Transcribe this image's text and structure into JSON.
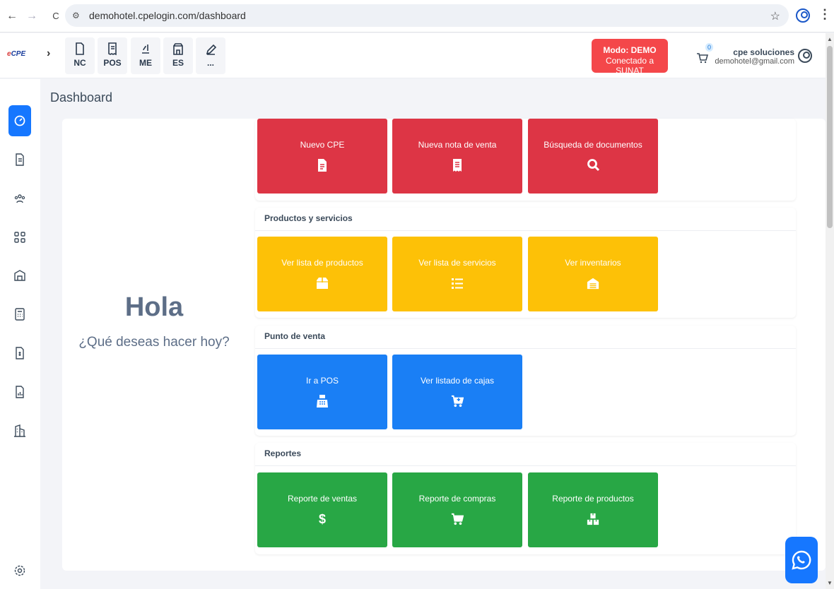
{
  "browser": {
    "url": "demohotel.cpelogin.com/dashboard",
    "back_icon": "←",
    "forward_icon": "→",
    "reload_icon": "C",
    "star_icon": "☆"
  },
  "topbar": {
    "logo_text_a": "CPE",
    "logo_text_b": "e",
    "expand_icon": "›",
    "quick_actions": [
      {
        "label": "NC",
        "icon": "doc-icon"
      },
      {
        "label": "POS",
        "icon": "receipt-icon"
      },
      {
        "label": "ME",
        "icon": "signature-icon"
      },
      {
        "label": "ES",
        "icon": "store-icon"
      },
      {
        "label": "...",
        "icon": "edit-icon"
      }
    ],
    "mode": {
      "title": "Modo: DEMO",
      "subtitle": "Conectado a SUNAT",
      "color": "#f4474a"
    },
    "cart_count": "0",
    "user_name": "cpe soluciones",
    "user_email": "demohotel@gmail.com"
  },
  "page": {
    "title": "Dashboard",
    "greeting": "Hola",
    "greeting_sub": "¿Qué deseas hacer hoy?"
  },
  "sections": [
    {
      "title": "",
      "color": "#dd3545",
      "tiles": [
        {
          "label": "Nuevo CPE",
          "icon": "file-icon"
        },
        {
          "label": "Nueva nota de venta",
          "icon": "receipt-icon"
        },
        {
          "label": "Búsqueda de documentos",
          "icon": "search-icon"
        }
      ]
    },
    {
      "title": "Productos y servicios",
      "color": "#fdc107",
      "tiles": [
        {
          "label": "Ver lista de productos",
          "icon": "box-icon"
        },
        {
          "label": "Ver lista de servicios",
          "icon": "list-icon"
        },
        {
          "label": "Ver inventarios",
          "icon": "warehouse-icon"
        }
      ]
    },
    {
      "title": "Punto de venta",
      "color": "#1a7ff5",
      "tiles": [
        {
          "label": "Ir a POS",
          "icon": "cash-register-icon"
        },
        {
          "label": "Ver listado de cajas",
          "icon": "cart-plus-icon"
        }
      ]
    },
    {
      "title": "Reportes",
      "color": "#28a745",
      "tiles": [
        {
          "label": "Reporte de ventas",
          "icon": "dollar-icon",
          "glyph": "$"
        },
        {
          "label": "Reporte de compras",
          "icon": "cart-icon"
        },
        {
          "label": "Reporte de productos",
          "icon": "boxes-icon"
        }
      ]
    }
  ],
  "sidebar_items": [
    "dashboard-icon",
    "document-icon",
    "users-icon",
    "apps-icon",
    "warehouse-icon",
    "calculator-icon",
    "file-dollar-icon",
    "report-icon",
    "building-icon",
    "settings-icon"
  ]
}
